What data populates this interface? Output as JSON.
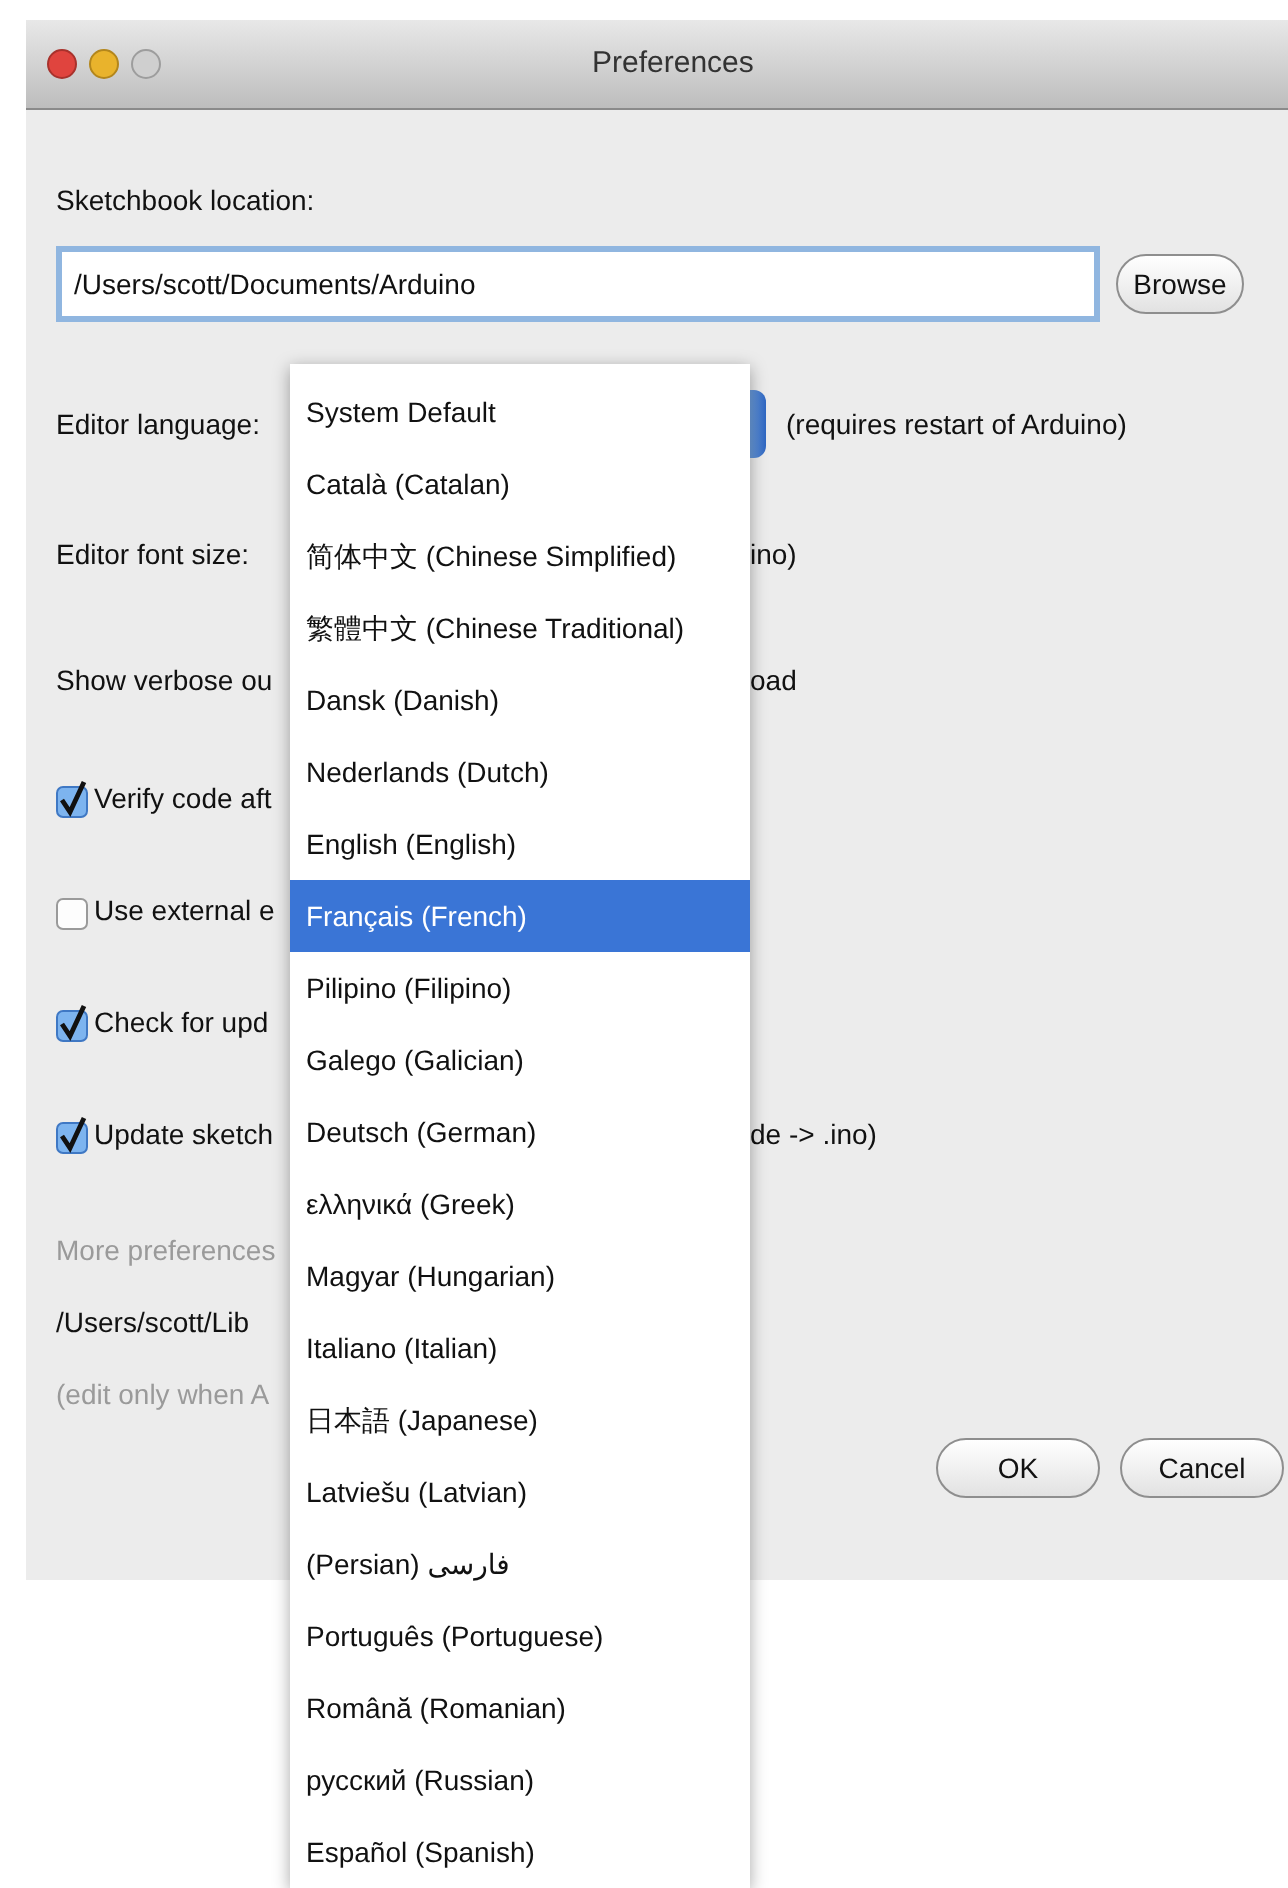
{
  "window": {
    "title": "Preferences"
  },
  "sketchbook": {
    "label": "Sketchbook location:",
    "value": "/Users/scott/Documents/Arduino",
    "browse": "Browse"
  },
  "rows": [
    {
      "kind": "popup",
      "left": "Editor language:",
      "right": "(requires restart of Arduino)"
    },
    {
      "kind": "text",
      "left": "Editor font size:",
      "right": "ino)"
    },
    {
      "kind": "text",
      "left": "Show verbose ou",
      "right": "oad"
    },
    {
      "kind": "checkbox",
      "checked": true,
      "left": "Verify code aft"
    },
    {
      "kind": "checkbox",
      "checked": false,
      "left": "Use external e"
    },
    {
      "kind": "checkbox",
      "checked": true,
      "left": "Check for upd"
    },
    {
      "kind": "checkbox",
      "checked": true,
      "left": "Update sketch",
      "right": "de -> .ino)"
    }
  ],
  "notes": [
    {
      "kind": "hint",
      "text": "More preferences"
    },
    {
      "kind": "path",
      "text": "/Users/scott/Lib"
    },
    {
      "kind": "hint",
      "text": "(edit only when A"
    }
  ],
  "buttons": [
    "OK",
    "Cancel"
  ],
  "language_menu": [
    {
      "label": "System Default",
      "selected": false
    },
    {
      "label": "Català (Catalan)",
      "selected": false
    },
    {
      "label": "简体中文 (Chinese Simplified)",
      "selected": false
    },
    {
      "label": "繁體中文 (Chinese Traditional)",
      "selected": false
    },
    {
      "label": "Dansk (Danish)",
      "selected": false
    },
    {
      "label": "Nederlands (Dutch)",
      "selected": false
    },
    {
      "label": "English (English)",
      "selected": false
    },
    {
      "label": "Français (French)",
      "selected": true
    },
    {
      "label": "Pilipino (Filipino)",
      "selected": false
    },
    {
      "label": "Galego (Galician)",
      "selected": false
    },
    {
      "label": "Deutsch (German)",
      "selected": false
    },
    {
      "label": "ελληνικά (Greek)",
      "selected": false
    },
    {
      "label": "Magyar (Hungarian)",
      "selected": false
    },
    {
      "label": "Italiano (Italian)",
      "selected": false
    },
    {
      "label": "日本語 (Japanese)",
      "selected": false
    },
    {
      "label": "Latviešu (Latvian)",
      "selected": false
    },
    {
      "label": "(Persian) فارسی",
      "selected": false
    },
    {
      "label": "Português (Portuguese)",
      "selected": false
    },
    {
      "label": "Română (Romanian)",
      "selected": false
    },
    {
      "label": "русский (Russian)",
      "selected": false
    },
    {
      "label": "Español (Spanish)",
      "selected": false
    }
  ]
}
